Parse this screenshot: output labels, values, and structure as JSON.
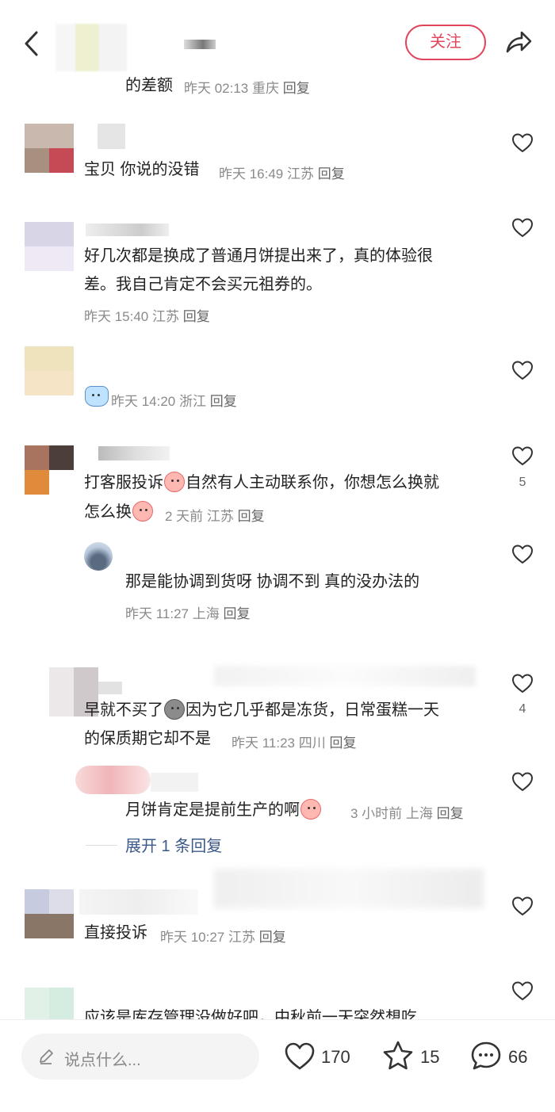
{
  "header": {
    "follow_label": "关注"
  },
  "comments": [
    {
      "text": "的差额",
      "meta": "昨天 02:13 重庆",
      "reply": "回复"
    },
    {
      "text": "宝贝 你说的没错",
      "meta": "昨天 16:49 江苏",
      "reply": "回复"
    },
    {
      "text_line1": "好几次都是换成了普通月饼提出来了，真的体验很",
      "text_line2": "差。我自己肯定不会买元祖券的。",
      "meta": "昨天 15:40 江苏",
      "reply": "回复"
    },
    {
      "meta": "昨天 14:20 浙江",
      "reply": "回复"
    },
    {
      "text_a": "打客服投诉",
      "text_b": "自然有人主动联系你，你想怎么换就",
      "text_c": "怎么换",
      "meta": "2 天前 江苏",
      "reply": "回复",
      "like_count": "5"
    },
    {
      "text": "那是能协调到货呀  协调不到  真的没办法的",
      "meta": "昨天 11:27 上海",
      "reply": "回复"
    },
    {
      "text_a": "早就不买了",
      "text_b": "因为它几乎都是冻货，日常蛋糕一天",
      "text_c": "的保质期它却不是",
      "meta": "昨天 11:23 四川",
      "reply": "回复",
      "like_count": "4"
    },
    {
      "text": "月饼肯定是提前生产的啊",
      "meta": "3 小时前 上海",
      "reply": "回复"
    },
    {
      "expand_label": "展开 1 条回复"
    },
    {
      "text": "直接投诉",
      "meta": "昨天 10:27 江苏",
      "reply": "回复"
    },
    {
      "text": "应该是库存管理没做好吧，中秋前一天突然想吃"
    }
  ],
  "bottom_bar": {
    "input_placeholder": "说点什么...",
    "likes": "170",
    "stars": "15",
    "comments": "66"
  },
  "colors": {
    "accent": "#e0455b",
    "link": "#3b5a8a"
  }
}
